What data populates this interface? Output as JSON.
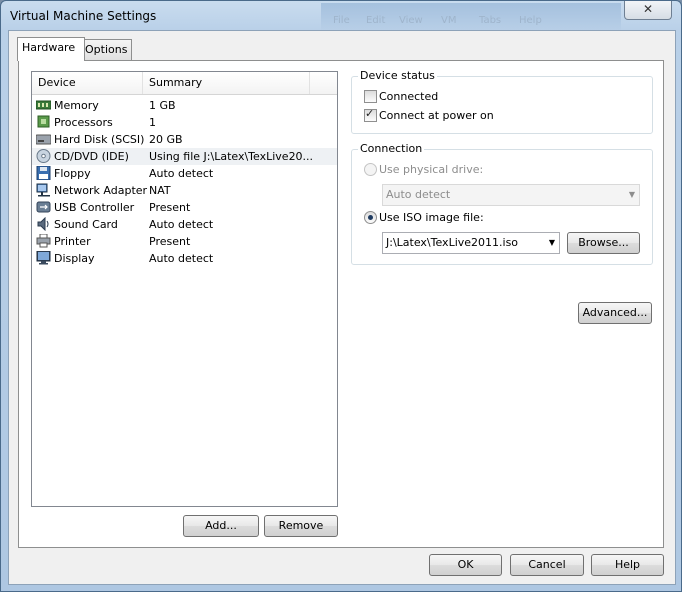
{
  "window": {
    "title": "Virtual Machine Settings",
    "close_glyph": "✕"
  },
  "background_menu": [
    "File",
    "Edit",
    "View",
    "VM",
    "Tabs",
    "Help"
  ],
  "tabs": [
    {
      "label": "Hardware"
    },
    {
      "label": "Options"
    }
  ],
  "device_list": {
    "headers": {
      "device": "Device",
      "summary": "Summary"
    },
    "rows": [
      {
        "device": "Memory",
        "summary": "1 GB",
        "icon": "memory-icon"
      },
      {
        "device": "Processors",
        "summary": "1",
        "icon": "processor-icon"
      },
      {
        "device": "Hard Disk (SCSI)",
        "summary": "20 GB",
        "icon": "hard-disk-icon"
      },
      {
        "device": "CD/DVD (IDE)",
        "summary": "Using file J:\\Latex\\TexLive20...",
        "icon": "cd-dvd-icon"
      },
      {
        "device": "Floppy",
        "summary": "Auto detect",
        "icon": "floppy-icon"
      },
      {
        "device": "Network Adapter",
        "summary": "NAT",
        "icon": "network-adapter-icon"
      },
      {
        "device": "USB Controller",
        "summary": "Present",
        "icon": "usb-icon"
      },
      {
        "device": "Sound Card",
        "summary": "Auto detect",
        "icon": "sound-card-icon"
      },
      {
        "device": "Printer",
        "summary": "Present",
        "icon": "printer-icon"
      },
      {
        "device": "Display",
        "summary": "Auto detect",
        "icon": "display-icon"
      }
    ]
  },
  "list_buttons": {
    "add": "Add...",
    "remove": "Remove"
  },
  "device_status": {
    "title": "Device status",
    "connected": {
      "label": "Connected",
      "checked": false
    },
    "connect_at_power_on": {
      "label": "Connect at power on",
      "checked": true
    }
  },
  "connection": {
    "title": "Connection",
    "physical_drive": {
      "label": "Use physical drive:",
      "selected": false,
      "enabled": false
    },
    "physical_drive_value": "Auto detect",
    "iso_image": {
      "label": "Use ISO image file:",
      "selected": true
    },
    "iso_path": "J:\\Latex\\TexLive2011.iso",
    "browse": "Browse..."
  },
  "advanced": "Advanced...",
  "footer": {
    "ok": "OK",
    "cancel": "Cancel",
    "help": "Help"
  }
}
